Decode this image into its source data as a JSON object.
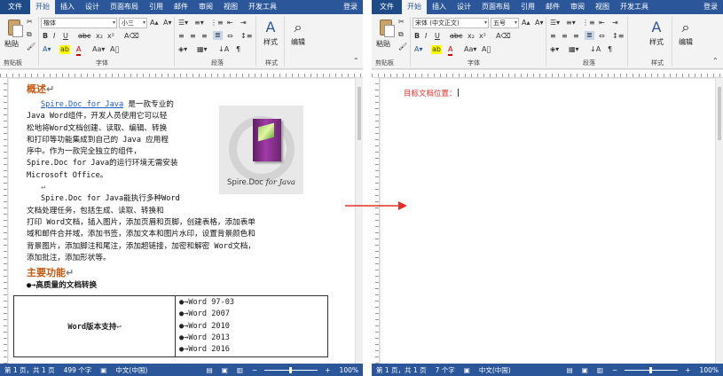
{
  "left": {
    "tabs": [
      "文件",
      "开始",
      "插入",
      "设计",
      "页面布局",
      "引用",
      "邮件",
      "审阅",
      "视图",
      "开发工具"
    ],
    "login": "登录",
    "font_name": "楷体",
    "font_size": "小三",
    "clipboard": {
      "paste": "粘贴",
      "group": "剪贴板"
    },
    "groups": {
      "font": "字体",
      "paragraph": "段落",
      "styles": "样式",
      "editing": "编辑"
    },
    "styles_label": "样式",
    "editing_label": "编辑",
    "status": {
      "page": "第 1 页，共 1 页",
      "words": "499 个字",
      "lang": "中文(中国)",
      "zoom": "100%"
    }
  },
  "right": {
    "tabs": [
      "文件",
      "开始",
      "插入",
      "设计",
      "页面布局",
      "引用",
      "邮件",
      "审阅",
      "视图",
      "开发工具"
    ],
    "login": "登录",
    "font_name": "宋体 (中文正文)",
    "font_size": "五号",
    "clipboard": {
      "paste": "粘贴",
      "group": "剪贴板"
    },
    "groups": {
      "font": "字体",
      "paragraph": "段落",
      "styles": "样式",
      "editing": "编辑"
    },
    "styles_label": "样式",
    "editing_label": "编辑",
    "target_text": "目标文档位置：",
    "status": {
      "page": "第 1 页，共 1 页",
      "words": "7 个字",
      "lang": "中文(中国)",
      "zoom": "100%"
    }
  },
  "doc": {
    "h1": "概述",
    "p1_link": "Spire.Doc for Java",
    "p1_lines": [
      " 是一款专业的",
      "Java Word组件，开发人员使用它可以轻",
      "松地将Word文档创建、读取、编辑、转换",
      "和打印等功能集成到自己的 Java 应用程",
      "序中。作为一款完全独立的组件，",
      "Spire.Doc for Java的运行环境无需安装",
      "Microsoft Office。"
    ],
    "p2_lines": [
      "Spire.Doc for Java能执行多种Word",
      "文档处理任务，包括生成、读取、转换和",
      "打印 Word文档，插入图片，添加页眉和页脚，创建表格，添加表单",
      "域和邮件合并域，添加书签，添加文本和图片水印，设置背景颜色和",
      "背景图片，添加脚注和尾注，添加超链接，加密和解密 Word文档，",
      "添加批注，添加形状等。"
    ],
    "h2": "主要功能",
    "bullet1": "●→高质量的文档转换",
    "table_left": "Word版本支持",
    "table_items": [
      "●→Word 97-03",
      "●→Word 2007",
      "●→Word 2010",
      "●→Word 2013",
      "●→Word 2016"
    ],
    "image_caption_a": "Spire.Doc",
    "image_caption_b": "for Java"
  },
  "colors": {
    "brand": "#2b579a",
    "heading": "#c55a11",
    "link": "#1f5cc2",
    "target": "#e1302a",
    "arrow": "#e1302a"
  }
}
